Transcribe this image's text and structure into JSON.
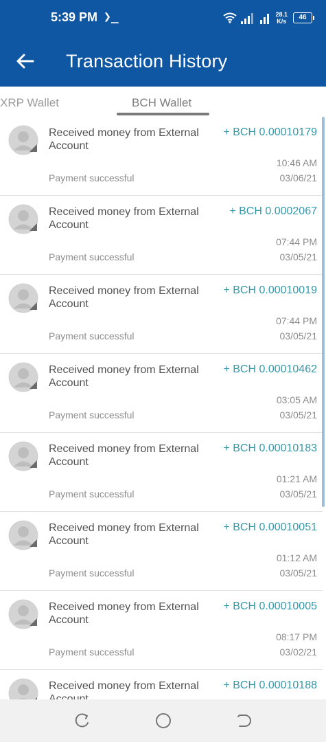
{
  "status_bar": {
    "time": "5:39 PM",
    "prompt": "❯_",
    "speed_top": "28.1",
    "speed_bottom": "K/s",
    "battery": "46"
  },
  "header": {
    "title": "Transaction History"
  },
  "tabs": [
    {
      "label": "XRP Wallet",
      "selected": false
    },
    {
      "label": "BCH Wallet",
      "selected": true
    }
  ],
  "colors": {
    "primary": "#0f57a3",
    "amount": "#3399aa",
    "secondary_text": "#8c8c8c"
  },
  "transactions": [
    {
      "description": "Received money from External Account",
      "amount": "+ BCH 0.00010179",
      "time": "10:46 AM",
      "status": "Payment successful",
      "date": "03/06/21"
    },
    {
      "description": "Received money from External Account",
      "amount": "+ BCH 0.0002067",
      "time": "07:44 PM",
      "status": "Payment successful",
      "date": "03/05/21"
    },
    {
      "description": "Received money from External Account",
      "amount": "+ BCH 0.00010019",
      "time": "07:44 PM",
      "status": "Payment successful",
      "date": "03/05/21"
    },
    {
      "description": "Received money from External Account",
      "amount": "+ BCH 0.00010462",
      "time": "03:05 AM",
      "status": "Payment successful",
      "date": "03/05/21"
    },
    {
      "description": "Received money from External Account",
      "amount": "+ BCH 0.00010183",
      "time": "01:21 AM",
      "status": "Payment successful",
      "date": "03/05/21"
    },
    {
      "description": "Received money from External Account",
      "amount": "+ BCH 0.00010051",
      "time": "01:12 AM",
      "status": "Payment successful",
      "date": "03/05/21"
    },
    {
      "description": "Received money from External Account",
      "amount": "+ BCH 0.00010005",
      "time": "08:17 PM",
      "status": "Payment successful",
      "date": "03/02/21"
    },
    {
      "description": "Received money from External Account",
      "amount": "+ BCH 0.00010188",
      "time": "",
      "status": "",
      "date": ""
    }
  ],
  "nav_icons": [
    "recent-apps-icon",
    "home-icon",
    "back-icon"
  ]
}
